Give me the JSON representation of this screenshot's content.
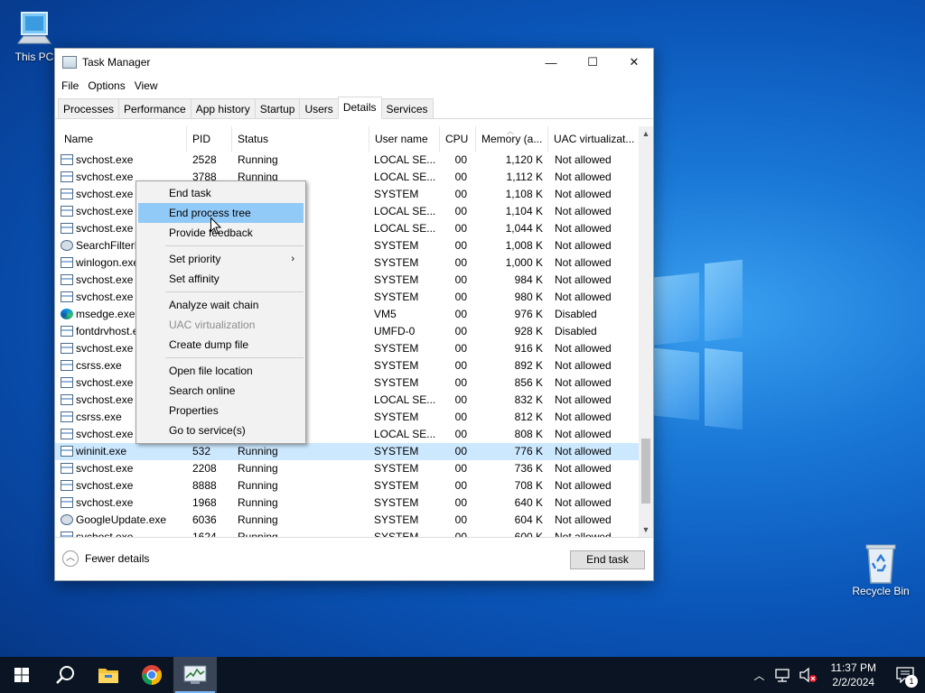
{
  "desktop": {
    "icons": [
      {
        "label": "This PC",
        "icon": "computer-icon"
      },
      {
        "label": "Recycle Bin",
        "icon": "recycle-bin-icon"
      }
    ]
  },
  "window": {
    "title": "Task Manager",
    "controls": {
      "minimize": "—",
      "maximize": "☐",
      "close": "✕"
    },
    "menu": [
      "File",
      "Options",
      "View"
    ],
    "tabs": [
      "Processes",
      "Performance",
      "App history",
      "Startup",
      "Users",
      "Details",
      "Services"
    ],
    "active_tab": "Details",
    "columns": [
      "Name",
      "PID",
      "Status",
      "User name",
      "CPU",
      "Memory (a...",
      "UAC virtualizat..."
    ],
    "rows": [
      {
        "name": "svchost.exe",
        "pid": "2528",
        "status": "Running",
        "user": "LOCAL SE...",
        "cpu": "00",
        "mem": "1,120 K",
        "uac": "Not allowed",
        "icon": "process-icon"
      },
      {
        "name": "svchost.exe",
        "pid": "3788",
        "status": "Running",
        "user": "LOCAL SE...",
        "cpu": "00",
        "mem": "1,112 K",
        "uac": "Not allowed",
        "icon": "process-icon"
      },
      {
        "name": "svchost.exe",
        "pid": "",
        "status": "",
        "user": "SYSTEM",
        "cpu": "00",
        "mem": "1,108 K",
        "uac": "Not allowed",
        "icon": "process-icon"
      },
      {
        "name": "svchost.exe",
        "pid": "",
        "status": "",
        "user": "LOCAL SE...",
        "cpu": "00",
        "mem": "1,104 K",
        "uac": "Not allowed",
        "icon": "process-icon"
      },
      {
        "name": "svchost.exe",
        "pid": "",
        "status": "",
        "user": "LOCAL SE...",
        "cpu": "00",
        "mem": "1,044 K",
        "uac": "Not allowed",
        "icon": "process-icon"
      },
      {
        "name": "SearchFilterH",
        "pid": "",
        "status": "",
        "user": "SYSTEM",
        "cpu": "00",
        "mem": "1,008 K",
        "uac": "Not allowed",
        "icon": "search-filter-icon"
      },
      {
        "name": "winlogon.exe",
        "pid": "",
        "status": "",
        "user": "SYSTEM",
        "cpu": "00",
        "mem": "1,000 K",
        "uac": "Not allowed",
        "icon": "process-icon"
      },
      {
        "name": "svchost.exe",
        "pid": "",
        "status": "",
        "user": "SYSTEM",
        "cpu": "00",
        "mem": "984 K",
        "uac": "Not allowed",
        "icon": "process-icon"
      },
      {
        "name": "svchost.exe",
        "pid": "",
        "status": "",
        "user": "SYSTEM",
        "cpu": "00",
        "mem": "980 K",
        "uac": "Not allowed",
        "icon": "process-icon"
      },
      {
        "name": "msedge.exe",
        "pid": "",
        "status": "",
        "user": "VM5",
        "cpu": "00",
        "mem": "976 K",
        "uac": "Disabled",
        "icon": "edge-icon"
      },
      {
        "name": "fontdrvhost.e",
        "pid": "",
        "status": "",
        "user": "UMFD-0",
        "cpu": "00",
        "mem": "928 K",
        "uac": "Disabled",
        "icon": "process-icon"
      },
      {
        "name": "svchost.exe",
        "pid": "",
        "status": "",
        "user": "SYSTEM",
        "cpu": "00",
        "mem": "916 K",
        "uac": "Not allowed",
        "icon": "process-icon"
      },
      {
        "name": "csrss.exe",
        "pid": "",
        "status": "",
        "user": "SYSTEM",
        "cpu": "00",
        "mem": "892 K",
        "uac": "Not allowed",
        "icon": "process-icon"
      },
      {
        "name": "svchost.exe",
        "pid": "",
        "status": "",
        "user": "SYSTEM",
        "cpu": "00",
        "mem": "856 K",
        "uac": "Not allowed",
        "icon": "process-icon"
      },
      {
        "name": "svchost.exe",
        "pid": "",
        "status": "",
        "user": "LOCAL SE...",
        "cpu": "00",
        "mem": "832 K",
        "uac": "Not allowed",
        "icon": "process-icon"
      },
      {
        "name": "csrss.exe",
        "pid": "",
        "status": "",
        "user": "SYSTEM",
        "cpu": "00",
        "mem": "812 K",
        "uac": "Not allowed",
        "icon": "process-icon"
      },
      {
        "name": "svchost.exe",
        "pid": "",
        "status": "",
        "user": "LOCAL SE...",
        "cpu": "00",
        "mem": "808 K",
        "uac": "Not allowed",
        "icon": "process-icon"
      },
      {
        "name": "wininit.exe",
        "pid": "532",
        "status": "Running",
        "user": "SYSTEM",
        "cpu": "00",
        "mem": "776 K",
        "uac": "Not allowed",
        "icon": "process-icon",
        "selected": true
      },
      {
        "name": "svchost.exe",
        "pid": "2208",
        "status": "Running",
        "user": "SYSTEM",
        "cpu": "00",
        "mem": "736 K",
        "uac": "Not allowed",
        "icon": "process-icon"
      },
      {
        "name": "svchost.exe",
        "pid": "8888",
        "status": "Running",
        "user": "SYSTEM",
        "cpu": "00",
        "mem": "708 K",
        "uac": "Not allowed",
        "icon": "process-icon"
      },
      {
        "name": "svchost.exe",
        "pid": "1968",
        "status": "Running",
        "user": "SYSTEM",
        "cpu": "00",
        "mem": "640 K",
        "uac": "Not allowed",
        "icon": "process-icon"
      },
      {
        "name": "GoogleUpdate.exe",
        "pid": "6036",
        "status": "Running",
        "user": "SYSTEM",
        "cpu": "00",
        "mem": "604 K",
        "uac": "Not allowed",
        "icon": "google-update-icon"
      },
      {
        "name": "svchost.exe",
        "pid": "1624",
        "status": "Running",
        "user": "SYSTEM",
        "cpu": "00",
        "mem": "600 K",
        "uac": "Not allowed",
        "icon": "process-icon"
      }
    ],
    "footer": {
      "fewer_details": "Fewer details",
      "end_task": "End task"
    }
  },
  "context_menu": {
    "groups": [
      [
        {
          "label": "End task"
        },
        {
          "label": "End process tree",
          "highlighted": true
        },
        {
          "label": "Provide feedback"
        }
      ],
      [
        {
          "label": "Set priority",
          "submenu": true
        },
        {
          "label": "Set affinity"
        }
      ],
      [
        {
          "label": "Analyze wait chain"
        },
        {
          "label": "UAC virtualization",
          "disabled": true
        },
        {
          "label": "Create dump file"
        }
      ],
      [
        {
          "label": "Open file location"
        },
        {
          "label": "Search online"
        },
        {
          "label": "Properties"
        },
        {
          "label": "Go to service(s)"
        }
      ]
    ]
  },
  "taskbar": {
    "apps": [
      {
        "name": "start-button",
        "icon": "windows-logo-icon"
      },
      {
        "name": "search-button",
        "icon": "search-icon"
      },
      {
        "name": "file-explorer-button",
        "icon": "folder-icon"
      },
      {
        "name": "chrome-button",
        "icon": "chrome-icon"
      },
      {
        "name": "task-manager-button",
        "icon": "task-manager-icon",
        "active": true
      }
    ],
    "time": "11:37 PM",
    "date": "2/2/2024",
    "notification_count": "1"
  },
  "colors": {
    "selection": "#cce8ff",
    "menu_highlight": "#91c9f7",
    "taskbar": "#0b1422"
  }
}
